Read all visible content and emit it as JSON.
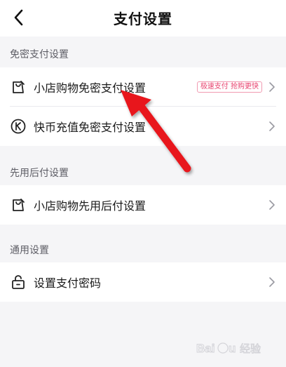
{
  "header": {
    "title": "支付设置"
  },
  "sections": {
    "password_free": {
      "label": "免密支付设置",
      "items": [
        {
          "label": "小店购物免密支付设置",
          "badge": "极速支付 抢购更快"
        },
        {
          "label": "快币充值免密支付设置"
        }
      ]
    },
    "pay_later": {
      "label": "先用后付设置",
      "items": [
        {
          "label": "小店购物先用后付设置"
        }
      ]
    },
    "general": {
      "label": "通用设置",
      "items": [
        {
          "label": "设置支付密码"
        }
      ]
    }
  },
  "icons": {
    "back": "chevron-left-icon",
    "shop_bag": "shopping-bag-icon",
    "kuaibi": "kuaibi-coin-icon",
    "lock": "lock-icon",
    "chevron": "chevron-right-icon"
  },
  "colors": {
    "badge_text": "#e8416d",
    "badge_border": "#f19ab1",
    "annotation_arrow": "#e8181f",
    "background": "#f5f5f7"
  },
  "watermark": {
    "text": "Baidu 经验"
  }
}
